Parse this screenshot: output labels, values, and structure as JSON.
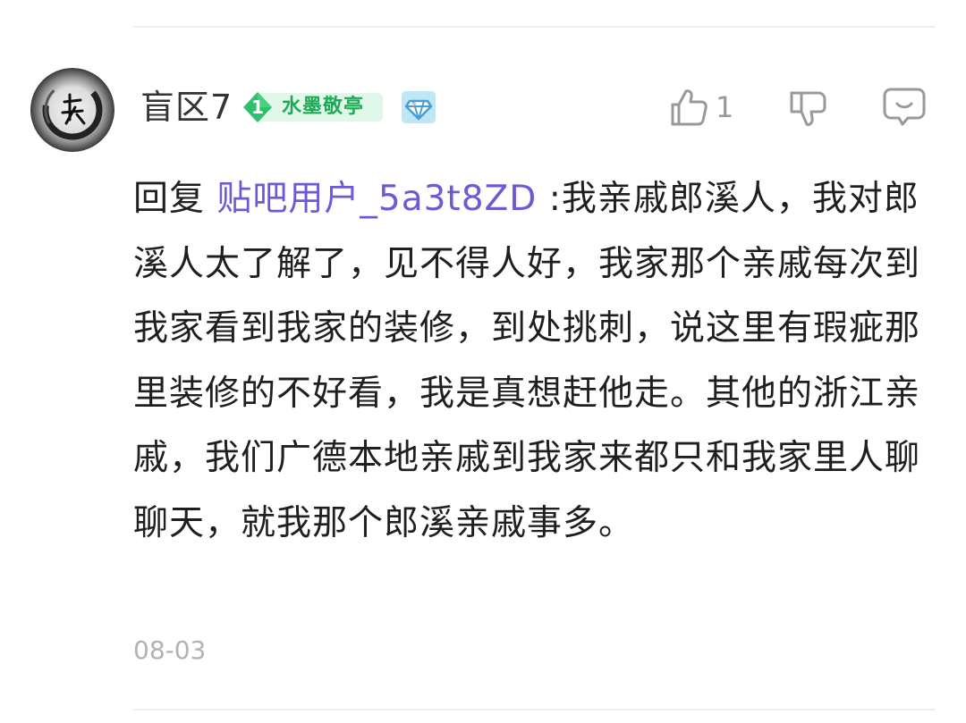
{
  "comment": {
    "author": {
      "username": "盲区7",
      "level": "1",
      "level_title": "水墨敬亭",
      "avatar_icon": "ink-circle-avatar",
      "vip_icon": "diamond-badge-icon"
    },
    "actions": {
      "like_icon": "thumbs-up-icon",
      "like_count": "1",
      "dislike_icon": "thumbs-down-icon",
      "reply_icon": "comment-bubble-icon"
    },
    "reply_prefix": "回复 ",
    "mention": "贴吧用户_5a3t8ZD",
    "body": " :我亲戚郎溪人，我对郎溪人太了解了，见不得人好，我家那个亲戚每次到我家看到我家的装修，到处挑刺，说这里有瑕疵那里装修的不好看，我是真想赶他走。其他的浙江亲戚，我们广德本地亲戚到我家来都只和我家里人聊聊天，就我那个郎溪亲戚事多。",
    "date": "08-03"
  },
  "colors": {
    "mention": "#6b5cd6",
    "level_badge_bg": "#e1f7ea",
    "level_badge_text": "#1fa956",
    "icon_gray": "#999999",
    "date_gray": "#b2b2b2"
  }
}
